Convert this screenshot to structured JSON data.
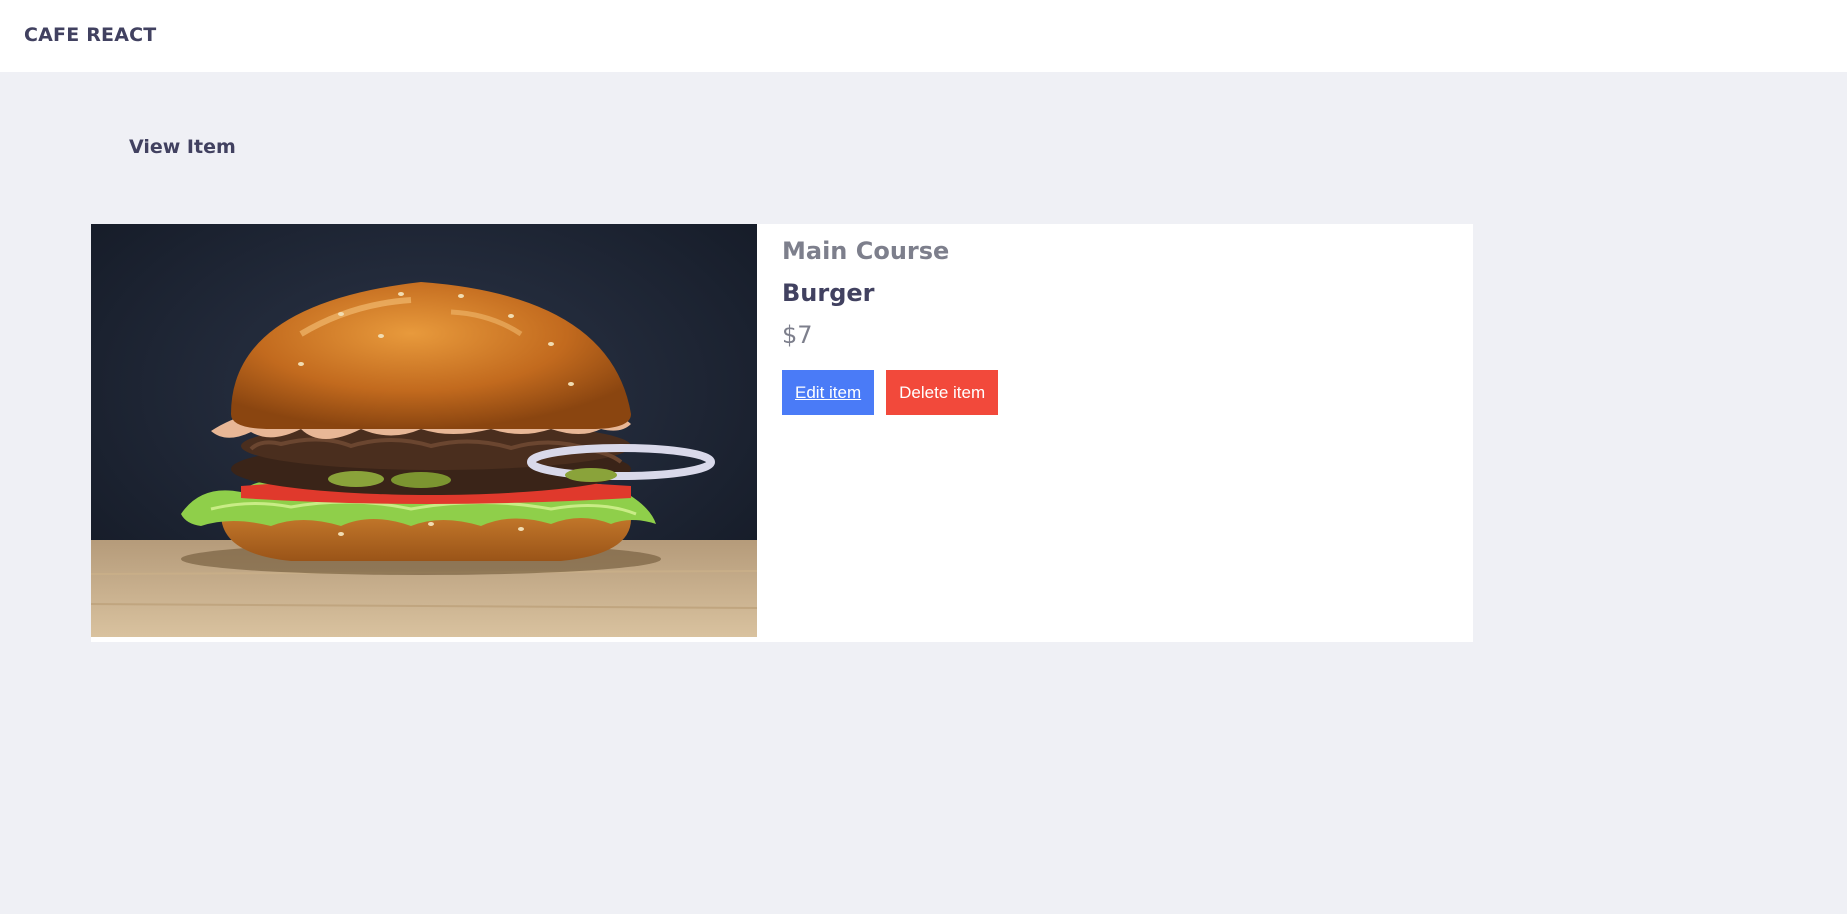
{
  "header": {
    "brand": "CAFE REACT"
  },
  "page": {
    "title": "View Item"
  },
  "item": {
    "category": "Main Course",
    "name": "Burger",
    "price": "$7",
    "image_subject": "burger-photo"
  },
  "actions": {
    "edit_label": "Edit item",
    "delete_label": "Delete item"
  },
  "colors": {
    "background": "#eff0f5",
    "header": "#ffffff",
    "text_dark": "#414160",
    "text_muted": "#7d7f8c",
    "edit_button": "#4a7bf7",
    "delete_button": "#f2493b"
  }
}
